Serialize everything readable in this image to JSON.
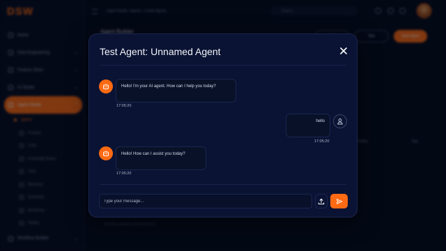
{
  "app": {
    "logo": "DSW",
    "breadcrumb": "⌂  Agent Studio  ›  Agents  ›  Create Agents",
    "search_placeholder": "Search...",
    "page_title": "Agent Builder",
    "buttons": {
      "filter": "Filter",
      "test": "Test",
      "save": "Save Agent"
    },
    "nav": [
      {
        "label": "Home",
        "icon": "home-icon"
      },
      {
        "label": "Data Engineering",
        "icon": "database-icon",
        "chevron": "⌄"
      },
      {
        "label": "Feature Store",
        "icon": "store-icon",
        "chevron": "⌄"
      },
      {
        "label": "AI Studio",
        "icon": "ai-icon",
        "chevron": "⌄"
      },
      {
        "label": "Agent Studio",
        "icon": "agent-icon",
        "chevron": "⌃",
        "active": true
      }
    ],
    "sub_nav": [
      "Agents",
      "Prompts",
      "LLMs",
      "Knowledge Bases",
      "Tools",
      "Memories",
      "Guardrails",
      "Monitoring",
      "Testing"
    ],
    "bottom_nav": {
      "label": "Workflow Builder",
      "chevron": "⌄"
    },
    "table_headers": [
      "Visibility",
      "Tags"
    ],
    "empty_note": "No data available at present time."
  },
  "modal": {
    "title": "Test Agent: Unnamed Agent",
    "messages": [
      {
        "role": "agent",
        "text": "Hello! I'm your AI agent. How can I help you today?",
        "time": "17:05:20"
      },
      {
        "role": "user",
        "text": "hello",
        "time": "17:05:20"
      },
      {
        "role": "agent",
        "text": "Hello! How can I assist you today?",
        "time": "17:05:20"
      }
    ],
    "input_placeholder": "Type your message...",
    "colors": {
      "accent": "#ff6a13",
      "modal_bg": "#0a1333",
      "page_bg": "#050a1c"
    }
  }
}
